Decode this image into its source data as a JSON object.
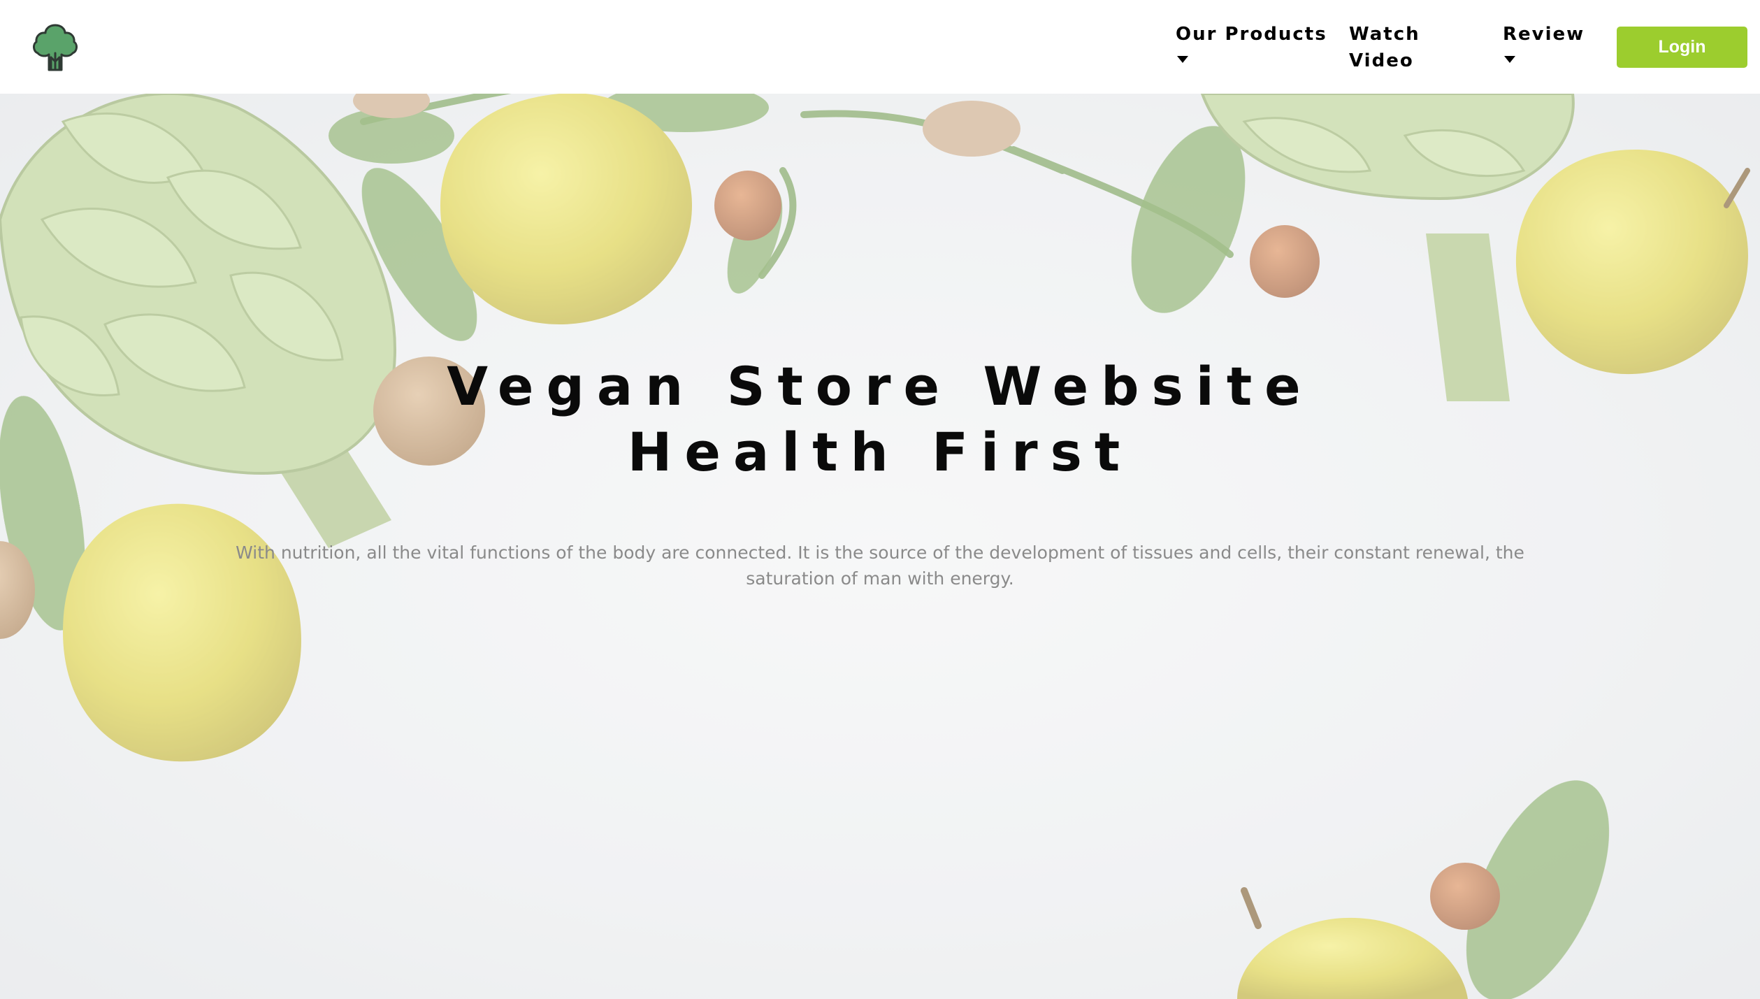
{
  "nav": {
    "products_label": "Our Products",
    "video_label_1": "Watch",
    "video_label_2": "Video",
    "review_label": "Review",
    "login_label": "Login"
  },
  "hero": {
    "title_line1": "Vegan Store Website",
    "title_line2": "Health First",
    "subtitle": "With nutrition, all the vital functions of the body are connected. It is the source of the development of tissues and cells, their constant renewal, the saturation of man with energy."
  },
  "colors": {
    "accent": "#9ccd2e",
    "logo": "#5aa36a"
  },
  "icons": [
    "broccoli-logo-icon",
    "caret-down-icon"
  ]
}
